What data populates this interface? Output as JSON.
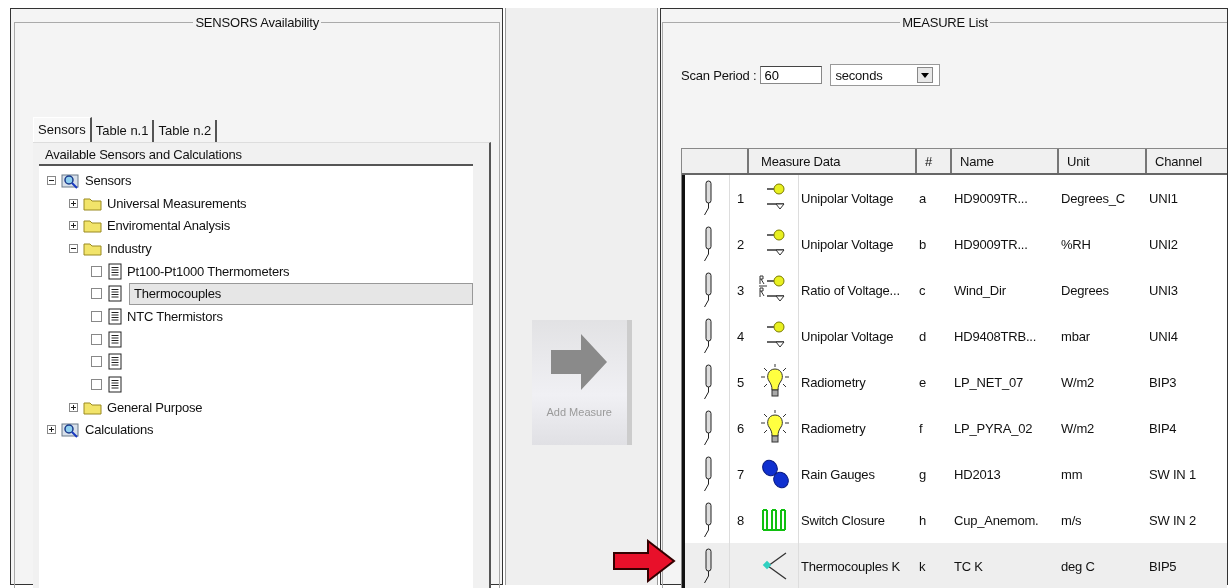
{
  "left_panel": {
    "title": "SENSORS Availability",
    "tabs": [
      {
        "label": "Sensors",
        "selected": true
      },
      {
        "label": "Table n.1",
        "selected": false
      },
      {
        "label": "Table n.2",
        "selected": false
      }
    ],
    "tree": {
      "header": "Available Sensors and Calculations",
      "items": [
        {
          "label": "Sensors",
          "kind": "root",
          "expanded": true,
          "children": [
            {
              "label": "Universal Measurements",
              "kind": "folder",
              "expanded": false
            },
            {
              "label": "Enviromental Analysis",
              "kind": "folder",
              "expanded": false
            },
            {
              "label": "Industry",
              "kind": "folder",
              "expanded": true,
              "children": [
                {
                  "label": "Pt100-Pt1000 Thermometers",
                  "kind": "leaf",
                  "checked": false,
                  "selected": false
                },
                {
                  "label": "Thermocouples",
                  "kind": "leaf",
                  "checked": false,
                  "selected": true
                },
                {
                  "label": "NTC Thermistors",
                  "kind": "leaf",
                  "checked": false,
                  "selected": false
                },
                {
                  "kind": "leaf",
                  "checked": false,
                  "selected": false
                },
                {
                  "kind": "leaf",
                  "checked": false,
                  "selected": false
                },
                {
                  "kind": "leaf",
                  "checked": false,
                  "selected": false
                }
              ]
            },
            {
              "label": "General Purpose",
              "kind": "folder",
              "expanded": false
            }
          ]
        },
        {
          "label": "Calculations",
          "kind": "root",
          "expanded": false
        }
      ]
    }
  },
  "add_button": {
    "label": "Add Measure",
    "disabled": true
  },
  "right_panel": {
    "title": "MEASURE List",
    "scan_period": {
      "label": "Scan Period :",
      "value": "60",
      "unit": "seconds"
    },
    "table": {
      "columns": [
        "Measure Data",
        "#",
        "Name",
        "Unit",
        "Channel"
      ],
      "rows": [
        {
          "number": "1",
          "kind": "voltage",
          "measure": "Unipolar Voltage",
          "letter": "a",
          "name": "HD9009TR...",
          "unit": "Degrees_C",
          "channel": "UNI1",
          "selected": false
        },
        {
          "number": "2",
          "kind": "voltage",
          "measure": "Unipolar Voltage",
          "letter": "b",
          "name": "HD9009TR...",
          "unit": "%RH",
          "channel": "UNI2",
          "selected": false
        },
        {
          "number": "3",
          "kind": "ratio",
          "measure": "Ratio of Voltage...",
          "letter": "c",
          "name": "Wind_Dir",
          "unit": "Degrees",
          "channel": "UNI3",
          "selected": false
        },
        {
          "number": "4",
          "kind": "voltage",
          "measure": "Unipolar Voltage",
          "letter": "d",
          "name": "HD9408TRB...",
          "unit": "mbar",
          "channel": "UNI4",
          "selected": false
        },
        {
          "number": "5",
          "kind": "radiometry",
          "measure": "Radiometry",
          "letter": "e",
          "name": "LP_NET_07",
          "unit": "W/m2",
          "channel": "BIP3",
          "selected": false
        },
        {
          "number": "6",
          "kind": "radiometry",
          "measure": "Radiometry",
          "letter": "f",
          "name": "LP_PYRA_02",
          "unit": "W/m2",
          "channel": "BIP4",
          "selected": false
        },
        {
          "number": "7",
          "kind": "rain",
          "measure": "Rain Gauges",
          "letter": "g",
          "name": "HD2013",
          "unit": "mm",
          "channel": "SW IN 1",
          "selected": false
        },
        {
          "number": "8",
          "kind": "switch",
          "measure": "Switch Closure",
          "letter": "h",
          "name": "Cup_Anemom.",
          "unit": "m/s",
          "channel": "SW IN 2",
          "selected": false
        },
        {
          "kind": "thermocouple",
          "measure": "Thermocouples  K",
          "letter": "k",
          "name": "TC K",
          "unit": "deg C",
          "channel": "BIP5",
          "selected": true
        }
      ]
    }
  }
}
